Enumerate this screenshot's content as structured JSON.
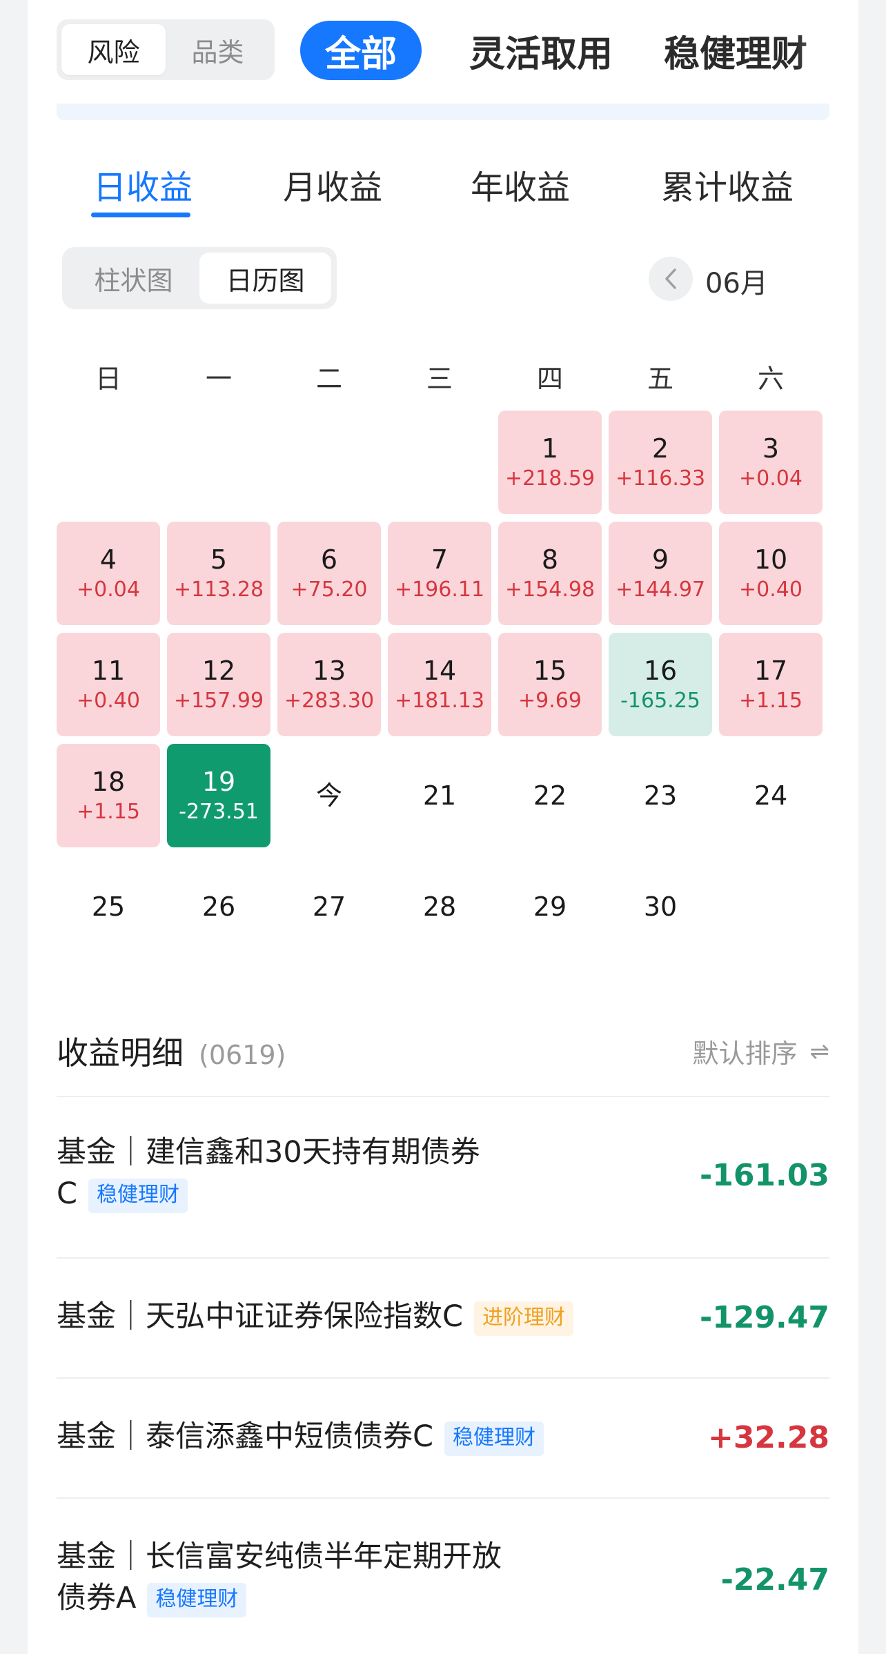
{
  "filters": {
    "segment": [
      "风险",
      "品类"
    ],
    "categories": [
      "全部",
      "灵活取用",
      "稳健理财"
    ]
  },
  "period_tabs": [
    "日收益",
    "月收益",
    "年收益",
    "累计收益"
  ],
  "view_toggle": [
    "柱状图",
    "日历图"
  ],
  "month": "06月",
  "weekdays": [
    "日",
    "一",
    "二",
    "三",
    "四",
    "五",
    "六"
  ],
  "calendar": [
    {
      "d": "1",
      "v": "+218.59"
    },
    {
      "d": "2",
      "v": "+116.33"
    },
    {
      "d": "3",
      "v": "+0.04"
    },
    {
      "d": "4",
      "v": "+0.04"
    },
    {
      "d": "5",
      "v": "+113.28"
    },
    {
      "d": "6",
      "v": "+75.20"
    },
    {
      "d": "7",
      "v": "+196.11"
    },
    {
      "d": "8",
      "v": "+154.98"
    },
    {
      "d": "9",
      "v": "+144.97"
    },
    {
      "d": "10",
      "v": "+0.40"
    },
    {
      "d": "11",
      "v": "+0.40"
    },
    {
      "d": "12",
      "v": "+157.99"
    },
    {
      "d": "13",
      "v": "+283.30"
    },
    {
      "d": "14",
      "v": "+181.13"
    },
    {
      "d": "15",
      "v": "+9.69"
    },
    {
      "d": "16",
      "v": "-165.25"
    },
    {
      "d": "17",
      "v": "+1.15"
    },
    {
      "d": "18",
      "v": "+1.15"
    },
    {
      "d": "19",
      "v": "-273.51"
    },
    {
      "d": "今",
      "v": ""
    },
    {
      "d": "21",
      "v": ""
    },
    {
      "d": "22",
      "v": ""
    },
    {
      "d": "23",
      "v": ""
    },
    {
      "d": "24",
      "v": ""
    },
    {
      "d": "25",
      "v": ""
    },
    {
      "d": "26",
      "v": ""
    },
    {
      "d": "27",
      "v": ""
    },
    {
      "d": "28",
      "v": ""
    },
    {
      "d": "29",
      "v": ""
    },
    {
      "d": "30",
      "v": ""
    }
  ],
  "detail": {
    "title": "收益明细",
    "date": "(0619)",
    "sort": "默认排序",
    "sort_icon": "⇌",
    "items": [
      {
        "line1": "基金｜建信鑫和30天持有期债券",
        "line2": "C",
        "tag": "稳健理财",
        "amount": "-161.03"
      },
      {
        "line1": "基金｜天弘中证证券保险指数C",
        "line2": "",
        "tag": "进阶理财",
        "amount": "-129.47"
      },
      {
        "line1": "基金｜泰信添鑫中短债债券C",
        "line2": "",
        "tag": "稳健理财",
        "amount": "+32.28"
      },
      {
        "line1": "基金｜长信富安纯债半年定期开放",
        "line2": "债券A",
        "tag": "稳健理财",
        "amount": "-22.47"
      }
    ]
  },
  "colors": {
    "accent": "#1677ff",
    "gain": "#d6363f",
    "loss": "#12936a",
    "gain_bg": "#fad6da",
    "loss_bg": "#d5ede6",
    "loss_strong_bg": "#109b6f"
  }
}
